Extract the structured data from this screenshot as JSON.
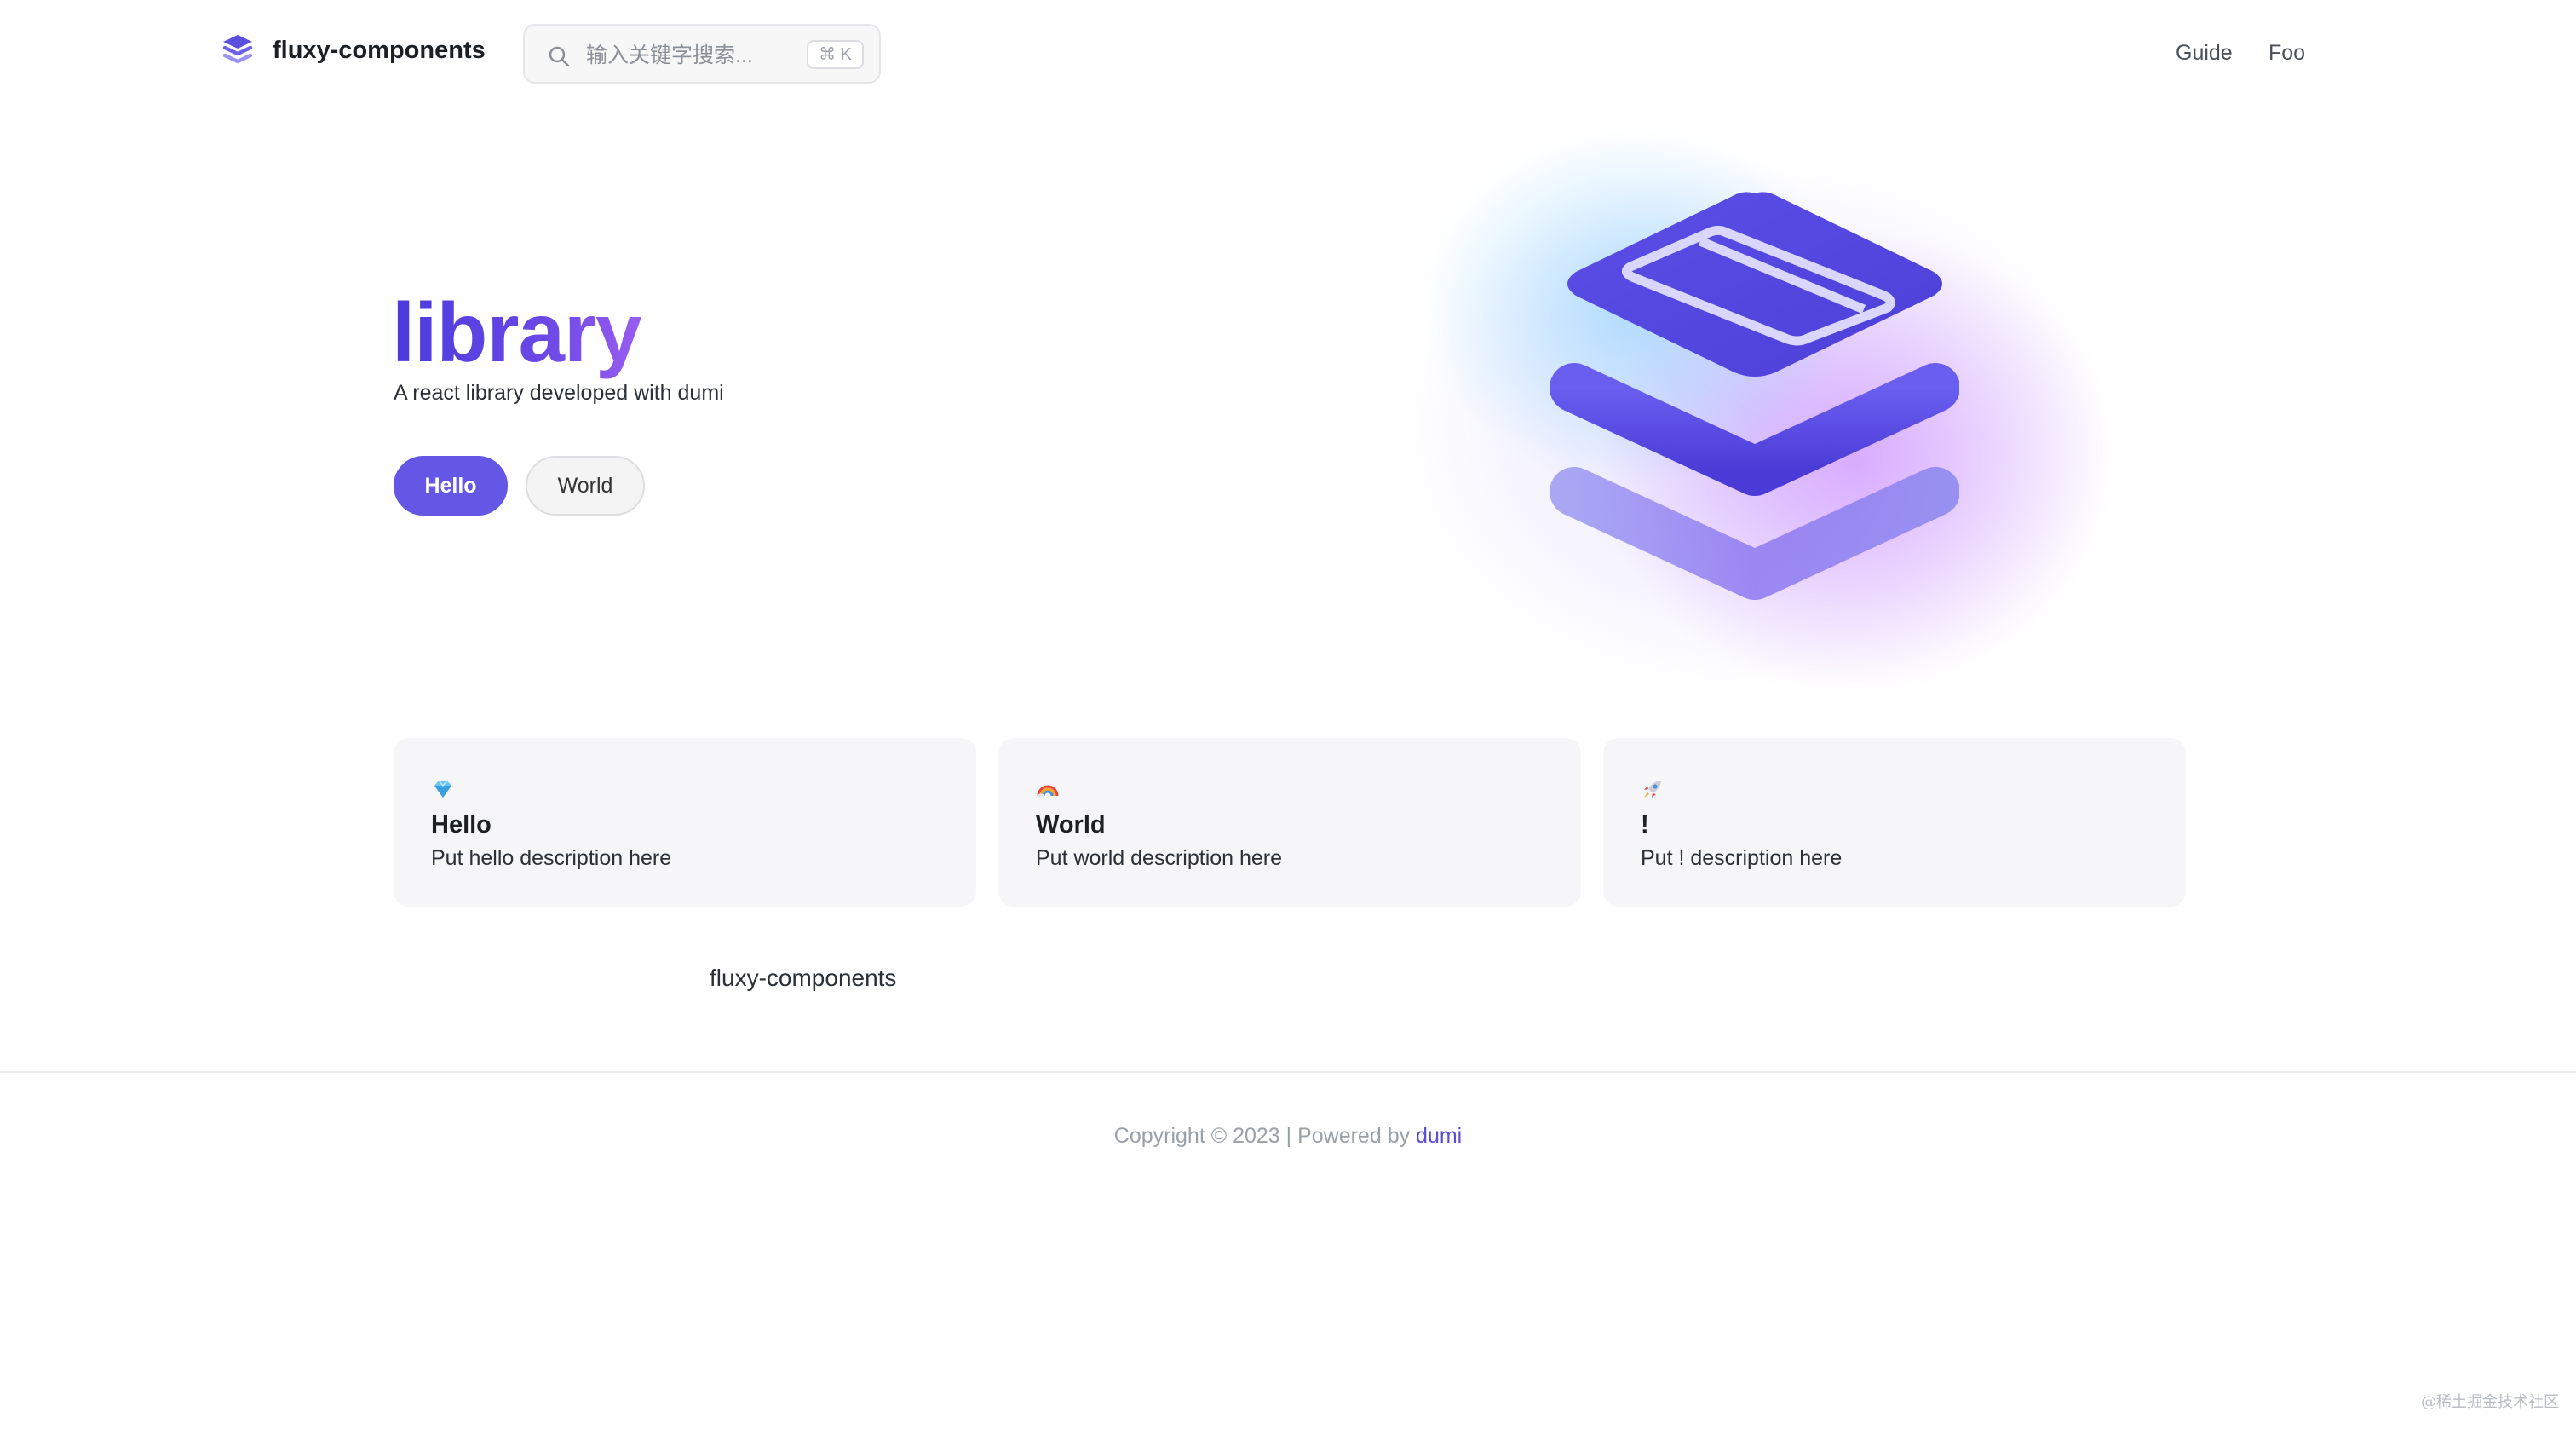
{
  "header": {
    "brand": "fluxy-components",
    "search": {
      "placeholder": "输入关键字搜索...",
      "shortcut": "⌘ K"
    },
    "nav": [
      {
        "label": "Guide"
      },
      {
        "label": "Foo"
      }
    ]
  },
  "hero": {
    "title": "library",
    "description": "A react library developed with dumi",
    "buttons": [
      {
        "label": "Hello"
      },
      {
        "label": "World"
      }
    ]
  },
  "features": [
    {
      "icon": "diamond-icon",
      "title": "Hello",
      "description": "Put hello description here"
    },
    {
      "icon": "rainbow-icon",
      "title": "World",
      "description": "Put world description here"
    },
    {
      "icon": "rocket-icon",
      "title": "!",
      "description": "Put ! description here"
    }
  ],
  "bottom_brand": "fluxy-components",
  "footer": {
    "text": "Copyright © 2023 | Powered by ",
    "link": "dumi"
  },
  "watermark": "@稀土掘金技术社区",
  "colors": {
    "accent": "#6457e6",
    "title_gradient_start": "#4a3bdc",
    "title_gradient_end": "#9a5cf0"
  }
}
